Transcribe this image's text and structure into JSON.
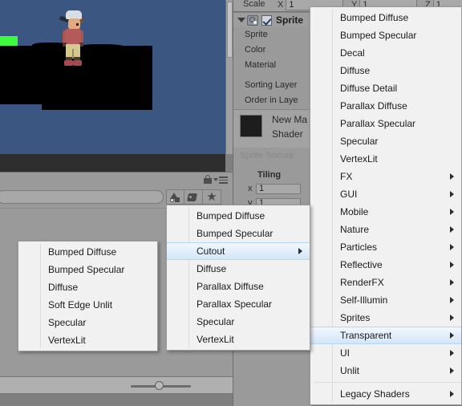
{
  "scene": {
    "name": "scene-view",
    "background_color": "#3b5680",
    "ground_color": "#000000",
    "green_block_color": "#3dfb3d"
  },
  "project_panel": {
    "search_placeholder": "",
    "search_value": "",
    "lock_icon": "lock-icon",
    "menu_icon": "hamburger-menu-icon",
    "filters": [
      {
        "name": "shapes-filter-icon",
        "label": ""
      },
      {
        "name": "tag-filter-icon",
        "label": ""
      },
      {
        "name": "favorites-filter-icon",
        "label": "★"
      }
    ],
    "zoom_slider_value": "40"
  },
  "inspector": {
    "scale": {
      "label": "Scale",
      "axes": [
        {
          "axis": "X",
          "value": "1"
        },
        {
          "axis": "Y",
          "value": "1"
        },
        {
          "axis": "Z",
          "value": "1"
        }
      ]
    },
    "component": {
      "title": "Sprite",
      "enabled": true,
      "icon": "sprite-renderer-icon",
      "fields": [
        {
          "label": "Sprite"
        },
        {
          "label": "Color"
        },
        {
          "label": "Material"
        },
        {
          "label": "Sorting Layer"
        },
        {
          "label": "Order in Laye"
        }
      ]
    },
    "material": {
      "name": "New Ma",
      "shader_label": "Shader",
      "swatch_color": "#1d1d1d"
    },
    "sprite_texture_label": "Sprite Texture",
    "tiling": {
      "label": "Tiling",
      "rows": [
        {
          "axis": "x",
          "value": "1"
        },
        {
          "axis": "y",
          "value": "1"
        }
      ]
    }
  },
  "menus": {
    "root": {
      "name": "shader-root-menu",
      "items": [
        {
          "label": "Bumped Diffuse",
          "submenu": false,
          "highlight": false
        },
        {
          "label": "Bumped Specular",
          "submenu": false,
          "highlight": false
        },
        {
          "label": "Decal",
          "submenu": false,
          "highlight": false
        },
        {
          "label": "Diffuse",
          "submenu": false,
          "highlight": false
        },
        {
          "label": "Diffuse Detail",
          "submenu": false,
          "highlight": false
        },
        {
          "label": "Parallax Diffuse",
          "submenu": false,
          "highlight": false
        },
        {
          "label": "Parallax Specular",
          "submenu": false,
          "highlight": false
        },
        {
          "label": "Specular",
          "submenu": false,
          "highlight": false
        },
        {
          "label": "VertexLit",
          "submenu": false,
          "highlight": false
        },
        {
          "label": "FX",
          "submenu": true,
          "highlight": false
        },
        {
          "label": "GUI",
          "submenu": true,
          "highlight": false
        },
        {
          "label": "Mobile",
          "submenu": true,
          "highlight": false
        },
        {
          "label": "Nature",
          "submenu": true,
          "highlight": false
        },
        {
          "label": "Particles",
          "submenu": true,
          "highlight": false
        },
        {
          "label": "Reflective",
          "submenu": true,
          "highlight": false
        },
        {
          "label": "RenderFX",
          "submenu": true,
          "highlight": false
        },
        {
          "label": "Self-Illumin",
          "submenu": true,
          "highlight": false
        },
        {
          "label": "Sprites",
          "submenu": true,
          "highlight": false
        },
        {
          "label": "Transparent",
          "submenu": true,
          "highlight": true
        },
        {
          "label": "UI",
          "submenu": true,
          "highlight": false
        },
        {
          "label": "Unlit",
          "submenu": true,
          "highlight": false
        },
        {
          "label": "Legacy Shaders",
          "submenu": true,
          "highlight": false,
          "separator_before": true
        }
      ]
    },
    "transparent": {
      "name": "transparent-submenu",
      "items": [
        {
          "label": "Bumped Diffuse",
          "submenu": false,
          "highlight": false
        },
        {
          "label": "Bumped Specular",
          "submenu": false,
          "highlight": false
        },
        {
          "label": "Cutout",
          "submenu": true,
          "highlight": true
        },
        {
          "label": "Diffuse",
          "submenu": false,
          "highlight": false
        },
        {
          "label": "Parallax Diffuse",
          "submenu": false,
          "highlight": false
        },
        {
          "label": "Parallax Specular",
          "submenu": false,
          "highlight": false
        },
        {
          "label": "Specular",
          "submenu": false,
          "highlight": false
        },
        {
          "label": "VertexLit",
          "submenu": false,
          "highlight": false
        }
      ]
    },
    "cutout": {
      "name": "cutout-submenu",
      "items": [
        {
          "label": "Bumped Diffuse",
          "submenu": false,
          "highlight": false
        },
        {
          "label": "Bumped Specular",
          "submenu": false,
          "highlight": false
        },
        {
          "label": "Diffuse",
          "submenu": false,
          "highlight": false
        },
        {
          "label": "Soft Edge Unlit",
          "submenu": false,
          "highlight": false
        },
        {
          "label": "Specular",
          "submenu": false,
          "highlight": false
        },
        {
          "label": "VertexLit",
          "submenu": false,
          "highlight": false
        }
      ]
    }
  }
}
